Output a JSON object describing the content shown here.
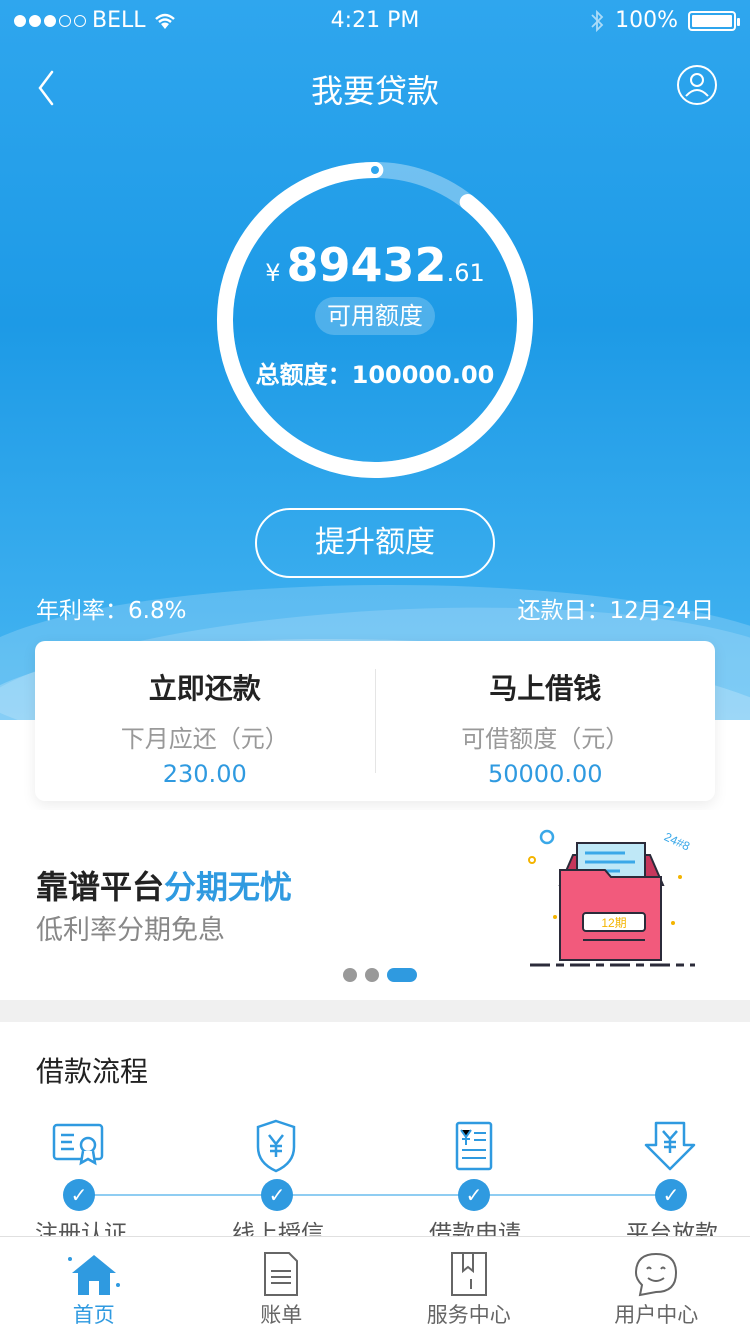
{
  "status_bar": {
    "carrier": "BELL",
    "time": "4:21 PM",
    "battery": "100%"
  },
  "nav": {
    "title": "我要贷款"
  },
  "credit": {
    "currency": "¥",
    "available_int": "89432",
    "available_dec": ".61",
    "available_label": "可用额度",
    "total_text": "总额度：100000.00",
    "available_fraction": 0.894
  },
  "raise_button": "提升额度",
  "annual_rate": "年利率：6.8%",
  "repay_date": "还款日：12月24日",
  "card": {
    "left": {
      "title": "立即还款",
      "sub": "下月应还（元）",
      "value": "230.00"
    },
    "right": {
      "title": "马上借钱",
      "sub": "可借额度（元）",
      "value": "50000.00"
    }
  },
  "banner": {
    "title_plain": "靠谱平台",
    "title_highlight": "分期无忧",
    "subtitle": "低利率分期免息",
    "illus_tag": "12期",
    "illus_code": "24#8"
  },
  "process": {
    "title": "借款流程",
    "steps": [
      "注册认证",
      "线上授信",
      "借款申请",
      "平台放款"
    ]
  },
  "tabbar": [
    "首页",
    "账单",
    "服务中心",
    "用户中心"
  ],
  "colors": {
    "accent": "#2f9ae0",
    "hero": "#1d9ae6"
  }
}
